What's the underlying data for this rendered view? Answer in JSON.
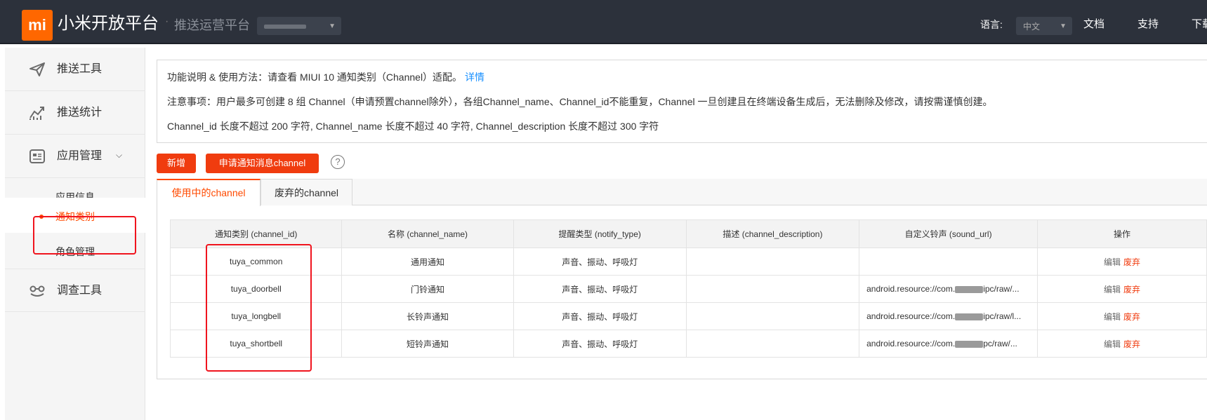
{
  "header": {
    "logo_text": "mi",
    "brand": "小米开放平台",
    "separator": "·",
    "sub_brand": "推送运营平台",
    "app_selector_value": "",
    "language_label": "语言:",
    "language_value": "中文",
    "nav_links": [
      "文档",
      "支持",
      "下载"
    ]
  },
  "sidebar": {
    "items": [
      {
        "label": "推送工具",
        "icon": "paper-plane-icon"
      },
      {
        "label": "推送统计",
        "icon": "line-chart-icon"
      },
      {
        "label": "应用管理",
        "icon": "app-card-icon",
        "expanded": true
      },
      {
        "label": "调查工具",
        "icon": "glasses-icon"
      }
    ],
    "sub_items": [
      {
        "label": "应用信息"
      },
      {
        "label": "通知类别",
        "active": true
      },
      {
        "label": "角色管理"
      }
    ]
  },
  "info": {
    "line1_text": "功能说明 & 使用方法：请查看 MIUI 10 通知类别（Channel）适配。",
    "line1_link": "详情",
    "line2": "注意事项：用户最多可创建 8 组 Channel（申请预置channel除外），各组Channel_name、Channel_id不能重复，Channel 一旦创建且在终端设备生成后，无法删除及修改，请按需谨慎创建。",
    "line3": "Channel_id 长度不超过 200 字符, Channel_name 长度不超过 40 字符, Channel_description 长度不超过 300 字符"
  },
  "actions": {
    "add_label": "新增",
    "apply_label": "申请通知消息channel",
    "help_glyph": "?"
  },
  "tabs": [
    {
      "label": "使用中的channel",
      "active": true
    },
    {
      "label": "废弃的channel",
      "active": false
    }
  ],
  "table": {
    "columns": [
      "通知类别 (channel_id)",
      "名称 (channel_name)",
      "提醒类型 (notify_type)",
      "描述 (channel_description)",
      "自定义铃声 (sound_url)",
      "操作"
    ],
    "rows": [
      {
        "channel_id": "tuya_common",
        "channel_name": "通用通知",
        "notify_type": "声音、振动、呼吸灯",
        "description": "",
        "sound_prefix": "",
        "sound_suffix": "",
        "edit": "编辑",
        "discard": "废弃"
      },
      {
        "channel_id": "tuya_doorbell",
        "channel_name": "门铃通知",
        "notify_type": "声音、振动、呼吸灯",
        "description": "",
        "sound_prefix": "android.resource://com.",
        "sound_suffix": "ipc/raw/...",
        "edit": "编辑",
        "discard": "废弃"
      },
      {
        "channel_id": "tuya_longbell",
        "channel_name": "长铃声通知",
        "notify_type": "声音、振动、呼吸灯",
        "description": "",
        "sound_prefix": "android.resource://com.",
        "sound_suffix": "ipc/raw/l...",
        "edit": "编辑",
        "discard": "废弃"
      },
      {
        "channel_id": "tuya_shortbell",
        "channel_name": "短铃声通知",
        "notify_type": "声音、振动、呼吸灯",
        "description": "",
        "sound_prefix": "android.resource://com.",
        "sound_suffix": "pc/raw/...",
        "edit": "编辑",
        "discard": "废弃"
      }
    ]
  },
  "colors": {
    "accent": "#ff4a00",
    "button": "#f03c0f",
    "header_bg": "#2c313b",
    "highlight_box": "#f0141e",
    "link": "#1890ff"
  }
}
